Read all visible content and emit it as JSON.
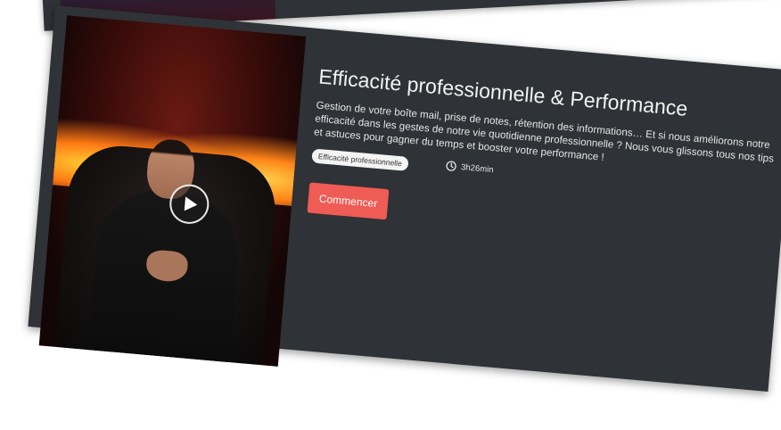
{
  "course": {
    "title": "Efficacité professionnelle & Performance",
    "description": "Gestion de votre boîte mail, prise de notes, rétention des informations… Et si nous améliorons notre efficacité dans les gestes de notre vie quotidienne professionnelle ? Nous vous glissons tous nos tips et astuces pour gagner du temps et booster votre performance !",
    "tag": "Efficacité professionnelle",
    "duration": "3h26min",
    "start_label": "Commencer"
  },
  "icons": {
    "play": "play-icon",
    "clock": "clock-icon"
  },
  "colors": {
    "card_background": "#2f3236",
    "accent": "#ef5b55",
    "tag_background": "#f4f4f4"
  }
}
